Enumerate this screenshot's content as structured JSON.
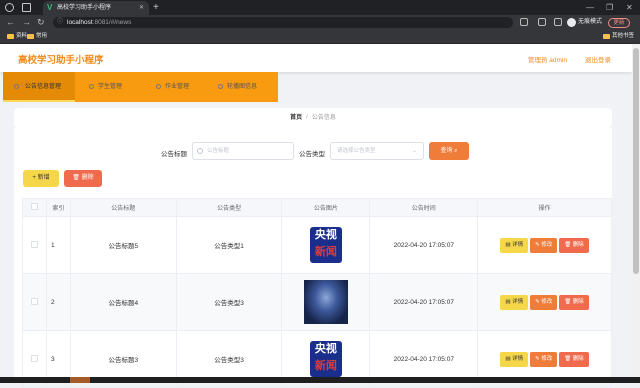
{
  "browser": {
    "tab_title": "高校学习助手小程序",
    "url_host": "localhost",
    "url_path": ":8081/#/news",
    "incognito_label": "无痕模式",
    "update_label": "更新",
    "bookmarks": [
      "资料",
      "常用"
    ],
    "other_bookmarks": "其他书签"
  },
  "header": {
    "title": "高校学习助手小程序",
    "admin_label": "管理员 admin",
    "logout_label": "退出登录"
  },
  "menu": [
    {
      "label": "公告信息管理"
    },
    {
      "label": "学生管理"
    },
    {
      "label": "作业管理"
    },
    {
      "label": "轮播图信息"
    }
  ],
  "breadcrumb": {
    "home": "首页",
    "sep": "/",
    "current": "公告信息"
  },
  "search": {
    "title_label": "公告标题",
    "title_placeholder": "公告标题",
    "type_label": "公告类型",
    "type_placeholder": "请选择公告类型",
    "query_label": "查询"
  },
  "actions": {
    "add_label": "+ 新增",
    "delete_label": "删除"
  },
  "table": {
    "headers": {
      "index": "索引",
      "title": "公告标题",
      "type": "公告类型",
      "image": "公告图片",
      "time": "公告时间",
      "ops": "操作"
    },
    "rows": [
      {
        "index": "1",
        "title": "公告标题5",
        "type": "公告类型1",
        "image": "cctv-news-logo",
        "time": "2022-04-20 17:05:07"
      },
      {
        "index": "2",
        "title": "公告标题4",
        "type": "公告类型3",
        "image": "stage-photo",
        "time": "2022-04-20 17:05:07"
      },
      {
        "index": "3",
        "title": "公告标题3",
        "type": "公告类型3",
        "image": "cctv-news-logo",
        "time": "2022-04-20 17:05:07"
      }
    ],
    "row_actions": {
      "detail": "详情",
      "edit": "修改",
      "delete": "删除"
    }
  },
  "logo_text": {
    "line1": "央视",
    "line2": "新闻"
  },
  "colors": {
    "accent": "#f28b1b",
    "menu_bg": "#f99b11",
    "query": "#f07c3a",
    "add": "#f7d74a",
    "danger": "#f06b4e"
  }
}
